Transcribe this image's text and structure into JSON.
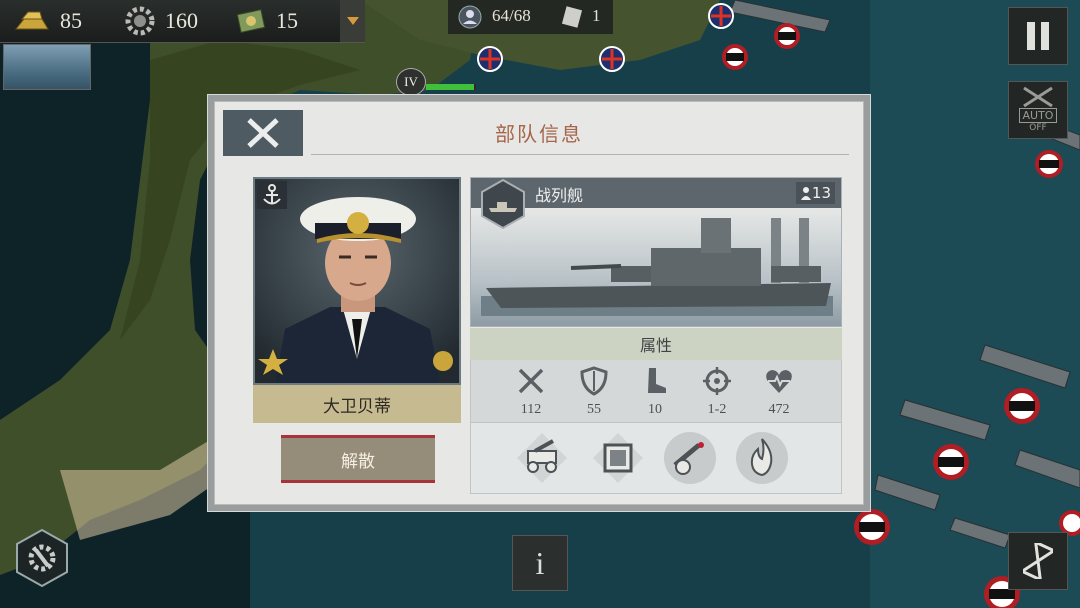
{
  "resources": [
    {
      "name": "gold",
      "icon": "gold-bars-icon",
      "value": "85"
    },
    {
      "name": "industry",
      "icon": "gear-icon",
      "value": "160"
    },
    {
      "name": "medals",
      "icon": "medal-card-icon",
      "value": "15"
    }
  ],
  "unit_bar": {
    "units": "64/68",
    "cards": "1"
  },
  "map": {
    "level_badge": "IV",
    "auto_label": "AUTO",
    "auto_state": "OFF"
  },
  "dialog": {
    "title": "部队信息",
    "commander_name": "大卫贝蒂",
    "disband_label": "解散",
    "ship_class": "战列舰",
    "crew_count": "13",
    "attributes_title": "属性",
    "stats": [
      {
        "name": "attack",
        "icon": "crossed-swords-icon",
        "value": "112"
      },
      {
        "name": "defense",
        "icon": "shield-icon",
        "value": "55"
      },
      {
        "name": "movement",
        "icon": "boot-icon",
        "value": "10"
      },
      {
        "name": "range",
        "icon": "crosshair-icon",
        "value": "1-2"
      },
      {
        "name": "hp",
        "icon": "heart-icon",
        "value": "472"
      }
    ],
    "abilities": [
      "cannon-cart-icon",
      "fortify-square-icon",
      "artillery-icon",
      "fire-icon"
    ]
  },
  "colors": {
    "title": "#a6654a",
    "accent_red": "#a8343a",
    "name_plate": "#c6ba91"
  }
}
